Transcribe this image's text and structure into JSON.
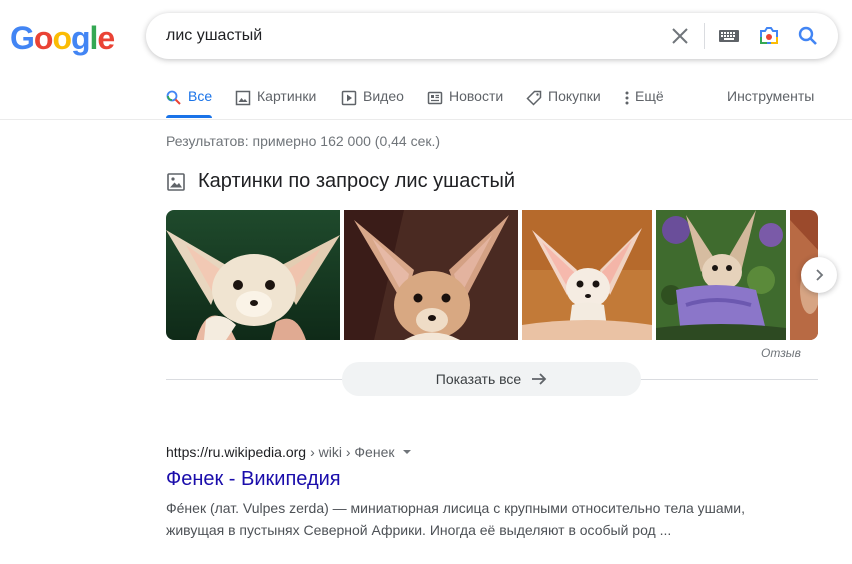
{
  "logo": {
    "letters": [
      "G",
      "o",
      "o",
      "g",
      "l",
      "e"
    ]
  },
  "search": {
    "query": "лис ушастый",
    "icons": [
      "close-icon",
      "keyboard-icon",
      "camera-icon",
      "search-icon"
    ]
  },
  "tabs": [
    {
      "label": "Все",
      "icon": "search-icon",
      "active": true
    },
    {
      "label": "Картинки",
      "icon": "image-icon",
      "active": false
    },
    {
      "label": "Видео",
      "icon": "video-icon",
      "active": false
    },
    {
      "label": "Новости",
      "icon": "news-icon",
      "active": false
    },
    {
      "label": "Покупки",
      "icon": "tag-icon",
      "active": false
    },
    {
      "label": "Ещё",
      "icon": "more-vert-icon",
      "active": false
    }
  ],
  "tools_label": "Инструменты",
  "results_stats": "Результатов: примерно 162 000 (0,44 сек.)",
  "images": {
    "title": "Картинки по запросу лис ушастый",
    "feedback": "Отзыв",
    "show_all": "Показать все",
    "thumbnails": [
      "fennec-fox-1",
      "fennec-fox-2",
      "fennec-fox-3",
      "fennec-fox-4",
      "fennec-fox-5"
    ]
  },
  "result": {
    "site": "https://ru.wikipedia.org",
    "path": " › wiki › Фенек",
    "title": "Фенек - Википедия",
    "snippet": "Фе́нек (лат. Vulpes zerda) — миниатюрная лисица с крупными относительно тела ушами, живущая в пустынях Северной Африки. Иногда её выделяют в особый род ..."
  },
  "colors": {
    "accent": "#1a73e8",
    "link": "#1a0dab",
    "google_blue": "#4285f4",
    "google_red": "#ea4335",
    "google_yellow": "#fbbc05",
    "google_green": "#34a853"
  }
}
